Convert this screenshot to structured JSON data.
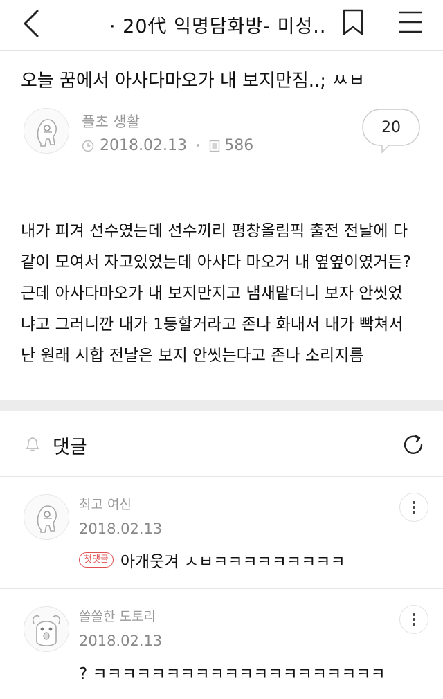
{
  "header": {
    "room_title": "· 20代 익명담화방- 미성.."
  },
  "post": {
    "title": "오늘 꿈에서 아사다마오가 내 보지만짐..; ㅆㅂ",
    "author": "플초 생활",
    "date": "2018.02.13",
    "views": "586",
    "comment_count": "20",
    "body_lines": [
      "내가 피겨 선수였는데 선수끼리 평창올림픽 출전 전날에 다",
      "같이 모여서 자고있었는데 아사다 마오거 내 옆옆이였거든?",
      "근데 아사다마오가 내 보지만지고 냄새맡더니 보자 안씻었",
      "냐고 그러니깐 내가 1등할거라고 존나 화내서 내가 빡쳐서",
      "난 원래 시합 전날은 보지 안씻는다고 존나 소리지름"
    ]
  },
  "comments_section": {
    "label": "댓글"
  },
  "comments": [
    {
      "nick": "최고 여신",
      "date": "2018.02.13",
      "badge": "첫댓글",
      "text": "아개웃겨 ㅅㅂㅋㅋㅋㅋㅋㅋㅋㅋㅋ"
    },
    {
      "nick": "쓸쓸한 도토리",
      "date": "2018.02.13",
      "text": "? ㅋㅋㅋㅋㅋㅋㅋㅋㅋㅋㅋㅋㅋㅋㅋㅋㅋㅋㅋㅋ"
    }
  ],
  "icons": {
    "back": "chevron-left-icon",
    "bookmark": "bookmark-icon",
    "menu": "hamburger-menu-icon",
    "clock": "clock-icon",
    "views": "document-icon",
    "bell": "bell-icon",
    "refresh": "refresh-icon",
    "more": "more-vertical-icon"
  },
  "colors": {
    "badge": "#e05050",
    "muted_text": "#888888",
    "divider": "#e6e6e6"
  }
}
